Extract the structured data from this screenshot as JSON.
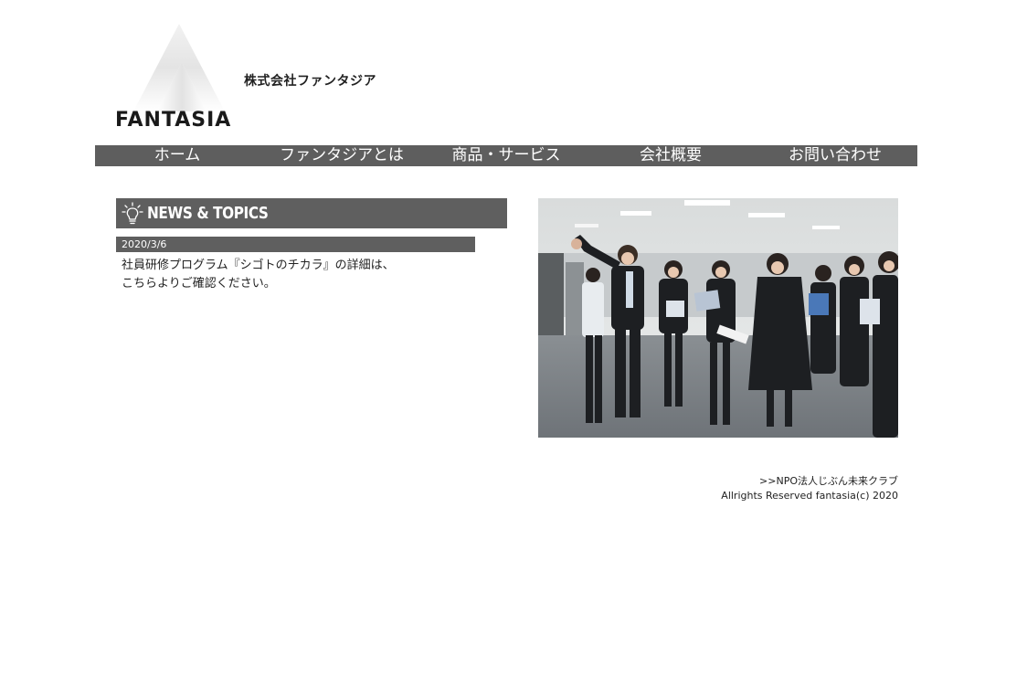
{
  "header": {
    "logo_text": "FANTASIA",
    "company_name": "株式会社ファンタジア"
  },
  "nav": {
    "items": [
      {
        "label": "ホーム"
      },
      {
        "label": "ファンタジアとは"
      },
      {
        "label": "商品・サービス"
      },
      {
        "label": "会社概要"
      },
      {
        "label": "お問い合わせ"
      }
    ]
  },
  "news": {
    "title": "NEWS & TOPICS",
    "icon": "lightbulb-icon",
    "date": "2020/3/6",
    "body_line1": "社員研修プログラム『シゴトのチカラ』の詳細は、",
    "body_line2": "こちらよりご確認ください。"
  },
  "footer": {
    "link": ">>NPO法人じぶん未来クラブ",
    "copyright": "Allrights Reserved fantasia(c) 2020"
  },
  "colors": {
    "bar_gray": "#5f5f5f",
    "text": "#222222",
    "background": "#ffffff"
  }
}
